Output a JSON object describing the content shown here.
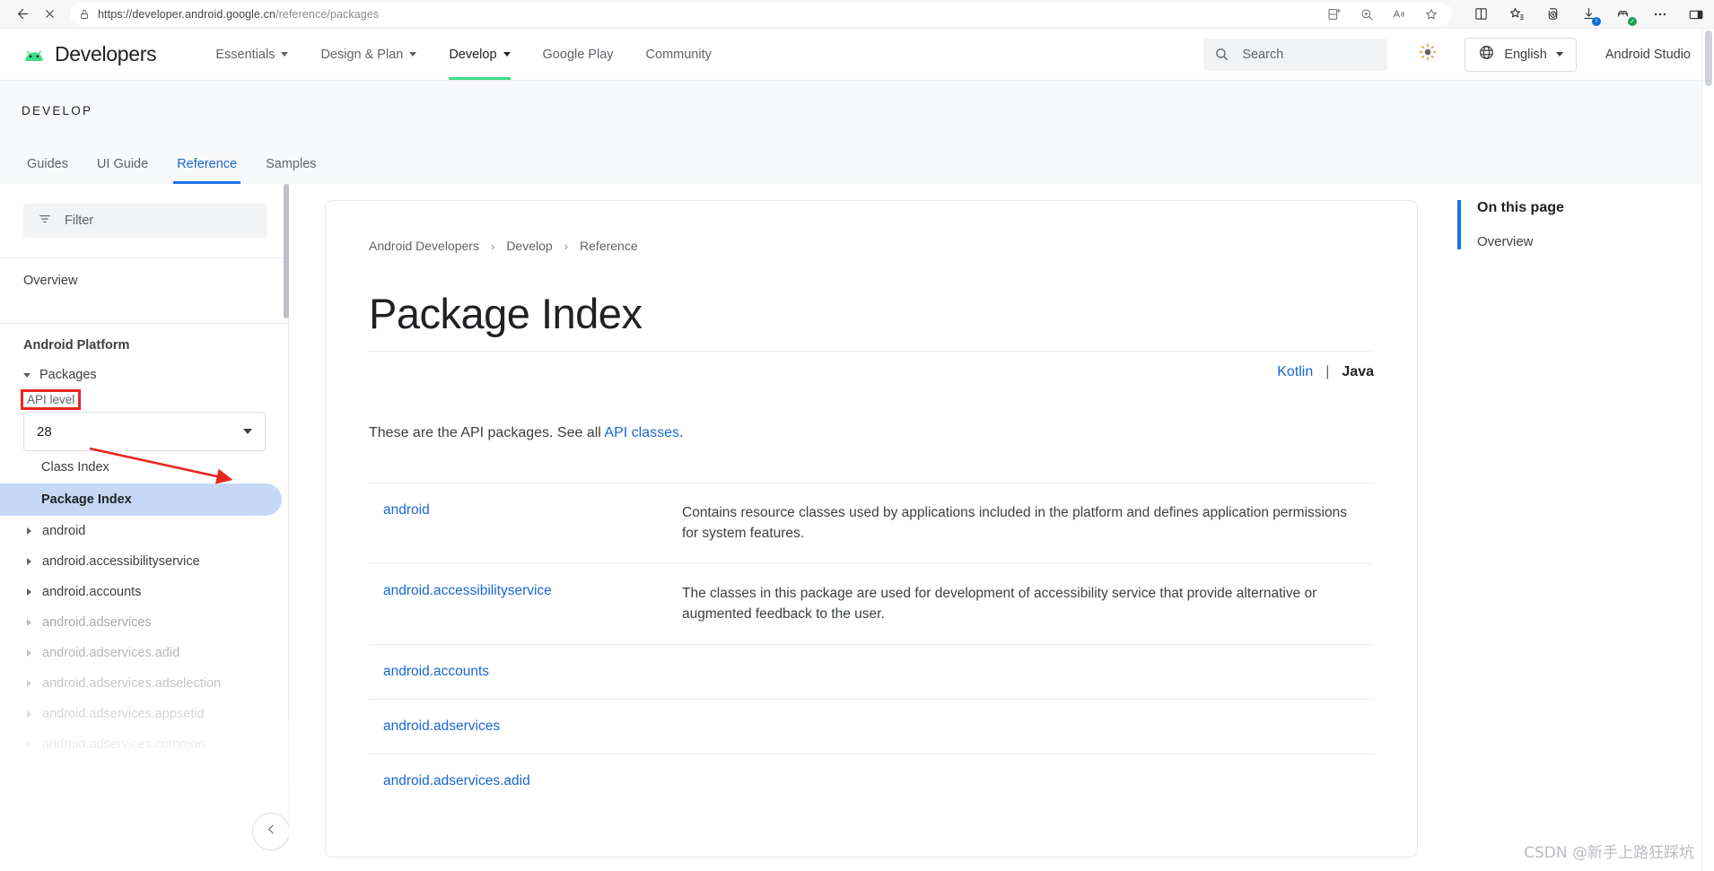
{
  "browser": {
    "url_secure": "https://developer.android.google.cn",
    "url_path": "/reference/packages",
    "back_icon": "back-arrow-icon",
    "close_icon": "close-icon",
    "lock_icon": "lock-icon",
    "omni_icons": [
      "split-screen-icon",
      "zoom-icon",
      "read-aloud-icon",
      "favorite-star-icon"
    ],
    "toolbar_icons": [
      "browser-essentials-icon",
      "favorites-icon",
      "collections-icon",
      "downloads-icon",
      "health-icon",
      "settings-more-icon",
      "sidebar-toggle-icon"
    ]
  },
  "header": {
    "brand": "Developers",
    "nav": [
      {
        "label": "Essentials",
        "has_caret": true,
        "active": false
      },
      {
        "label": "Design & Plan",
        "has_caret": true,
        "active": false
      },
      {
        "label": "Develop",
        "has_caret": true,
        "active": true
      },
      {
        "label": "Google Play",
        "has_caret": false,
        "active": false
      },
      {
        "label": "Community",
        "has_caret": false,
        "active": false
      }
    ],
    "search_placeholder": "Search",
    "theme_icon": "light-mode-icon",
    "language": "English",
    "studio_link": "Android Studio"
  },
  "section": {
    "kicker": "DEVELOP",
    "tabs": [
      {
        "label": "Guides",
        "active": false
      },
      {
        "label": "UI Guide",
        "active": false
      },
      {
        "label": "Reference",
        "active": true
      },
      {
        "label": "Samples",
        "active": false
      }
    ]
  },
  "sidebar": {
    "filter_placeholder": "Filter",
    "overview_label": "Overview",
    "group_title": "Android Platform",
    "packages_node": "Packages",
    "api_level_label": "API level",
    "api_level_value": "28",
    "sub_items": [
      {
        "label": "Class Index",
        "selected": false
      },
      {
        "label": "Package Index",
        "selected": true
      }
    ],
    "tree_items": [
      {
        "label": "android",
        "faded": 0
      },
      {
        "label": "android.accessibilityservice",
        "faded": 0
      },
      {
        "label": "android.accounts",
        "faded": 0
      },
      {
        "label": "android.adservices",
        "faded": 1
      },
      {
        "label": "android.adservices.adid",
        "faded": 2
      },
      {
        "label": "android.adservices.adselection",
        "faded": 3
      },
      {
        "label": "android.adservices.appsetid",
        "faded": 4
      },
      {
        "label": "android.adservices.common",
        "faded": 5
      }
    ],
    "collapse_icon": "chevron-left-icon"
  },
  "main": {
    "breadcrumb": [
      "Android Developers",
      "Develop",
      "Reference"
    ],
    "breadcrumb_sep": "›",
    "title": "Package Index",
    "lang_kotlin": "Kotlin",
    "lang_pipe": "|",
    "lang_java": "Java",
    "intro_before": "These are the API packages. See all ",
    "intro_link": "API classes",
    "intro_after": ".",
    "packages": [
      {
        "name": "android",
        "desc": "Contains resource classes used by applications included in the platform and defines application permissions for system features."
      },
      {
        "name": "android.accessibilityservice",
        "desc": "The classes in this package are used for development of accessibility service that provide alternative or augmented feedback to the user."
      },
      {
        "name": "android.accounts",
        "desc": ""
      },
      {
        "name": "android.adservices",
        "desc": ""
      },
      {
        "name": "android.adservices.adid",
        "desc": ""
      }
    ]
  },
  "toc": {
    "title": "On this page",
    "items": [
      "Overview"
    ]
  },
  "annotation": {
    "color": "#e8271c",
    "box_target": "API level",
    "arrow_target": "api-level-dropdown"
  },
  "watermark": "CSDN @新手上路狂踩坑",
  "colors": {
    "accent_blue": "#1a73e8",
    "link_blue": "#1967d2",
    "android_green": "#3ddc84",
    "selected_bg": "#c5d9f7",
    "annotation_red": "#e8271c"
  }
}
